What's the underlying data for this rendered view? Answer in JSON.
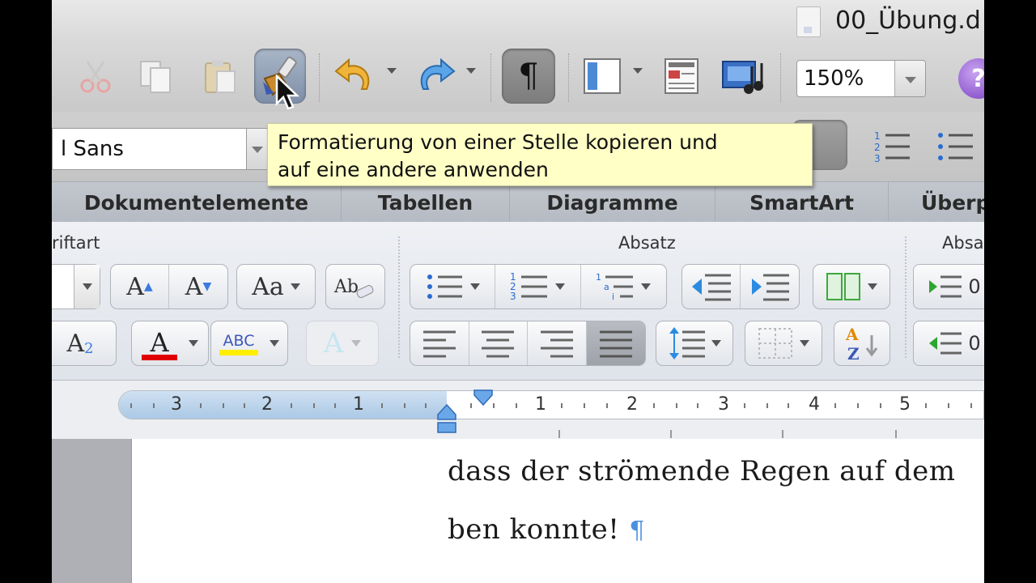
{
  "title_bar": {
    "document_title": "00_Übung.d"
  },
  "toolbar": {
    "zoom_value": "150%",
    "paragraph_mark": "¶",
    "help_label": "?"
  },
  "format_toolbar": {
    "font_name": "l Sans"
  },
  "tooltip": {
    "text_line1": "Formatierung von einer Stelle kopieren und",
    "text_line2": "auf eine andere anwenden"
  },
  "ribbon": {
    "tabs": [
      "Dokumentelemente",
      "Tabellen",
      "Diagramme",
      "SmartArt",
      "Überp"
    ],
    "groups": {
      "font_partial": "riftart",
      "paragraph": "Absatz",
      "styles_partial": "Absa"
    },
    "font_buttons": {
      "grow": "A",
      "shrink": "A",
      "case": "Aa",
      "clear": "Ab",
      "subscript": "A",
      "subscript_2": "2",
      "font_color": "A",
      "highlight": "ABC",
      "text_effects": "A"
    },
    "list_numbers": {
      "num1": "1",
      "num2": "2",
      "num3": "3"
    },
    "spacing_values": {
      "before": "0",
      "after": "0"
    },
    "sort_letters": {
      "a": "A",
      "z": "Z"
    }
  },
  "ruler": {
    "labels": [
      "3",
      "2",
      "1",
      "1",
      "2",
      "3",
      "4",
      "5"
    ]
  },
  "document": {
    "line1": "dass der strömende Regen auf dem",
    "line2": "ben konnte!",
    "pilcrow": "¶"
  },
  "colors": {
    "accent_blue": "#4a8fe0",
    "tooltip_bg": "#ffffc6",
    "font_color_red": "#e00000",
    "highlight_yellow": "#ffee00"
  }
}
